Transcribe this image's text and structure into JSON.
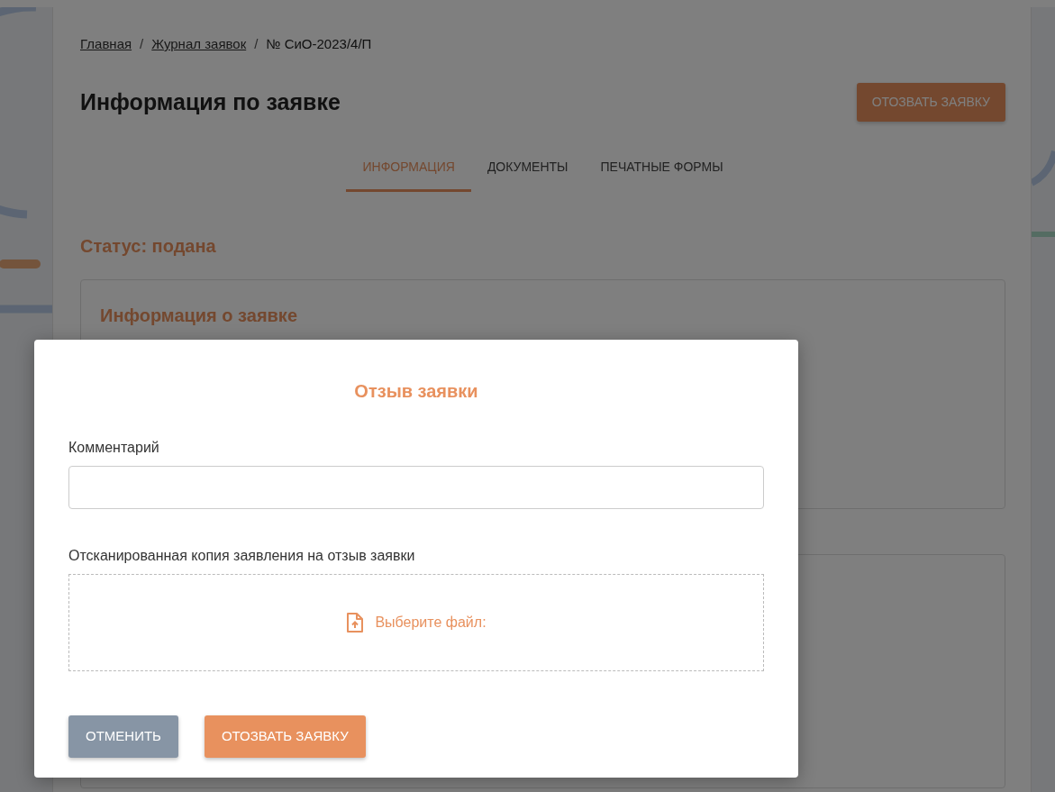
{
  "breadcrumb": {
    "separator": "/",
    "items": [
      {
        "label": "Главная",
        "link": true
      },
      {
        "label": "Журнал заявок",
        "link": true
      },
      {
        "label": "№ СиО-2023/4/П",
        "link": false
      }
    ]
  },
  "page_title": "Информация по заявке",
  "header_button": "ОТОЗВАТЬ ЗАЯВКУ",
  "tabs": [
    {
      "label": "ИНФОРМАЦИЯ",
      "selected": true
    },
    {
      "label": "ДОКУМЕНТЫ",
      "selected": false
    },
    {
      "label": "ПЕЧАТНЫЕ ФОРМЫ",
      "selected": false
    }
  ],
  "status": "Статус: подана",
  "info_card": {
    "title": "Информация о заявке"
  },
  "modal": {
    "title": "Отзыв заявки",
    "fields": [
      {
        "kind": "text",
        "label": "Комментарий"
      },
      {
        "kind": "file",
        "label": "Отсканированная копия заявления на отзыв заявки",
        "upload_text": "Выберите файл:"
      }
    ],
    "buttons": [
      {
        "kind": "secondary",
        "label": "ОТМЕНИТЬ"
      },
      {
        "kind": "primary",
        "label": "ОТОЗВАТЬ ЗАЯВКУ"
      }
    ]
  }
}
